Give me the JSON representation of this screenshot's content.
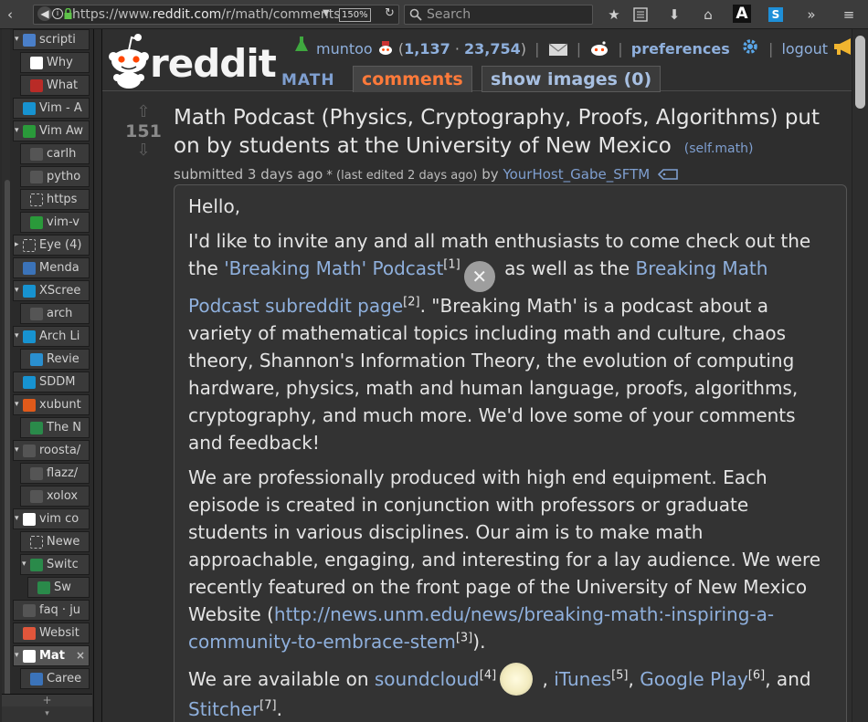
{
  "browser": {
    "url_prefix": "https://www.",
    "url_domain": "reddit.com",
    "url_path": "/r/math/comments",
    "zoom": "150%",
    "search_placeholder": "Search"
  },
  "sidebar": {
    "tabs": [
      {
        "title": "scripti",
        "twisty": "▾",
        "icon": "code-icon",
        "color": "#4a7fc9",
        "indent": 0
      },
      {
        "title": "Why",
        "icon": "reddit-icon",
        "color": "#ffffff",
        "indent": 1
      },
      {
        "title": "What",
        "icon": "quora-icon",
        "color": "#b92b27",
        "indent": 1
      },
      {
        "title": "Vim - A",
        "icon": "arch-icon",
        "color": "#1793d1",
        "indent": 0
      },
      {
        "title": "Vim Aw",
        "twisty": "▾",
        "icon": "vim-icon",
        "color": "#2a9a3a",
        "indent": 0
      },
      {
        "title": "carlh",
        "icon": "github-icon",
        "color": "#555555",
        "indent": 1
      },
      {
        "title": "pytho",
        "icon": "github-icon",
        "color": "#555555",
        "indent": 1
      },
      {
        "title": "https",
        "icon": "page-icon",
        "color": "#3a3a3a",
        "indent": 1
      },
      {
        "title": "vim-v",
        "icon": "vim-icon",
        "color": "#2a9a3a",
        "indent": 1
      },
      {
        "title": "Eye (4)",
        "twisty": "▸",
        "icon": "page-icon",
        "color": "#3a3a3a",
        "indent": 0
      },
      {
        "title": "Menda",
        "icon": "menda-icon",
        "color": "#3b73b9",
        "indent": 0
      },
      {
        "title": "XScree",
        "twisty": "▾",
        "icon": "arch-icon",
        "color": "#1793d1",
        "indent": 0
      },
      {
        "title": "arch",
        "icon": "github-icon",
        "color": "#555555",
        "indent": 1
      },
      {
        "title": "Arch Li",
        "twisty": "▾",
        "icon": "arch-icon",
        "color": "#1793d1",
        "indent": 0
      },
      {
        "title": "Revie",
        "icon": "gear-icon",
        "color": "#2a8fcf",
        "indent": 1
      },
      {
        "title": "SDDM",
        "icon": "arch-icon",
        "color": "#1793d1",
        "indent": 0
      },
      {
        "title": "xubunt",
        "twisty": "▾",
        "icon": "askubuntu-icon",
        "color": "#e05a1a",
        "indent": 0
      },
      {
        "title": "The N",
        "icon": "chart-icon",
        "color": "#2a8a4a",
        "indent": 1
      },
      {
        "title": "roosta/",
        "twisty": "▾",
        "icon": "github-icon",
        "color": "#555555",
        "indent": 0
      },
      {
        "title": "flazz/",
        "icon": "github-icon",
        "color": "#555555",
        "indent": 1
      },
      {
        "title": "xolox",
        "icon": "github-icon",
        "color": "#555555",
        "indent": 1
      },
      {
        "title": "vim co",
        "twisty": "▾",
        "icon": "google-icon",
        "color": "#ffffff",
        "indent": 0
      },
      {
        "title": "Newe",
        "icon": "page-icon",
        "color": "#3a3a3a",
        "indent": 1
      },
      {
        "title": "Switc",
        "twisty": "▾",
        "icon": "chart-icon",
        "color": "#2a8a4a",
        "indent": 1
      },
      {
        "title": "Sw",
        "icon": "chart-icon",
        "color": "#2a8a4a",
        "indent": 2
      },
      {
        "title": "faq · ju",
        "icon": "github-icon",
        "color": "#555555",
        "indent": 0
      },
      {
        "title": "Websit",
        "icon": "blocks-icon",
        "color": "#e0563b",
        "indent": 0
      },
      {
        "title": "Mat",
        "twisty": "▾",
        "icon": "reddit-icon",
        "color": "#ffffff",
        "indent": 0,
        "active": true,
        "close": "×"
      },
      {
        "title": "Caree",
        "icon": "calendar-icon",
        "color": "#3b73b9",
        "indent": 1
      }
    ],
    "new_tab": "+",
    "bottom_arrow": "▾"
  },
  "header": {
    "logo_text": "reddit",
    "subreddit": "MATH",
    "tabs": [
      {
        "label": "comments",
        "selected": true
      },
      {
        "label": "show images (0)",
        "selected": false
      }
    ],
    "user": {
      "name": "muntoo",
      "karma_link": "1,137",
      "karma_comment": "23,754",
      "preferences": "preferences",
      "logout": "logout"
    }
  },
  "post": {
    "score": "151",
    "title": "Math Podcast (Physics, Cryptography, Proofs, Algorithms) put on by students at the University of New Mexico",
    "domain": "(self.math)",
    "submitted": "submitted 3 days ago",
    "edited": " * (last edited 2 days ago)",
    "by": " by ",
    "author": "YourHost_Gabe_SFTM",
    "body": {
      "p1": "Hello,",
      "p2_a": "I'd like to invite any and all math enthusiasts to come check out the the ",
      "p2_link1": "'Breaking Math' Podcast",
      "p2_sup1": "[1]",
      "p2_b": " as well as the ",
      "p2_link2": "Breaking Math Podcast subreddit page",
      "p2_sup2": "[2]",
      "p2_c": ". \"Breaking Math' is a podcast about a variety of mathematical topics including math and culture, chaos theory, Shannon's Information Theory, the evolution of computing hardware, physics, math and human language, proofs, algorithms, cryptography, and much more. We'd love some of your comments and feedback!",
      "p3_a": "We are professionally produced with high end equipment. Each episode is created in conjunction with professors or graduate students in various disciplines. Our aim is to make math approachable, engaging, and interesting for a lay audience. We were recently featured on the front page of the University of New Mexico Website (",
      "p3_link": "http://news.unm.edu/news/breaking-math:-inspiring-a-community-to-embrace-stem",
      "p3_sup": "[3]",
      "p3_b": ").",
      "p4_a": "We are available on ",
      "p4_link1": "soundcloud",
      "p4_sup1": "[4]",
      "p4_b": " , ",
      "p4_link2": "iTunes",
      "p4_sup2": "[5]",
      "p4_c": ", ",
      "p4_link3": "Google Play",
      "p4_sup3": "[6]",
      "p4_d": ", and ",
      "p4_link4": "Stitcher",
      "p4_sup4": "[7]",
      "p4_e": ".",
      "close_glyph": "✕"
    }
  }
}
